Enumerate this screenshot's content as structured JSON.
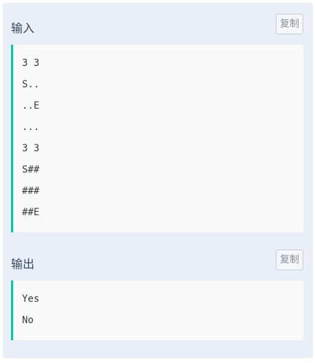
{
  "input_section": {
    "title": "输入",
    "copy_label": "复制",
    "lines": [
      "3 3",
      "S..",
      "..E",
      "...",
      "3 3",
      "S##",
      "###",
      "##E"
    ]
  },
  "output_section": {
    "title": "输出",
    "copy_label": "复制",
    "lines": [
      "Yes",
      "No"
    ]
  },
  "colors": {
    "panel_bg": "#eaeff7",
    "code_bg": "#f9f9f9",
    "accent_border": "#1abc9c"
  }
}
